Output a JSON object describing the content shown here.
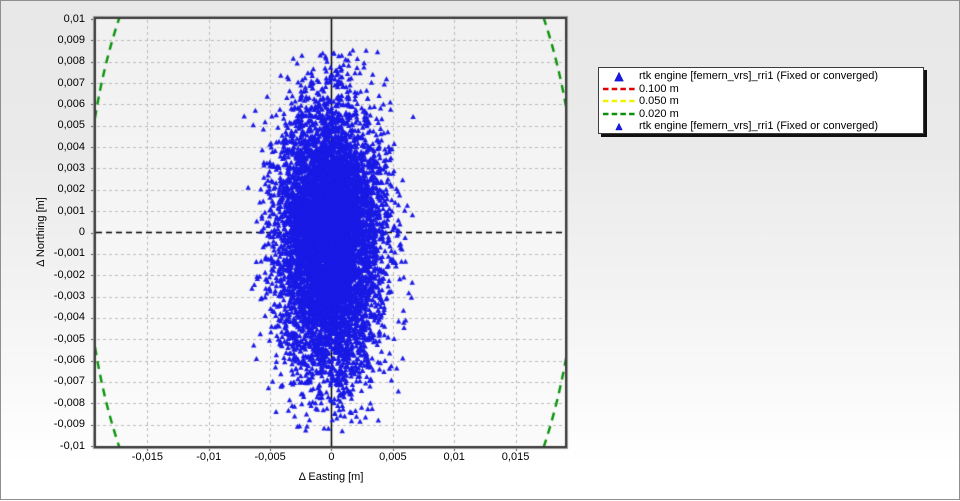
{
  "chart_data": {
    "type": "scatter",
    "xlabel": "Δ Easting [m]",
    "ylabel": "Δ Northing [m]",
    "xlim": [
      -0.01919,
      0.01903
    ],
    "ylim": [
      -0.01,
      0.01
    ],
    "x_ticks": [
      {
        "v": -0.015,
        "label": "-0,015"
      },
      {
        "v": -0.01,
        "label": "-0,01"
      },
      {
        "v": -0.005,
        "label": "-0,005"
      },
      {
        "v": 0,
        "label": "0"
      },
      {
        "v": 0.005,
        "label": "0,005"
      },
      {
        "v": 0.01,
        "label": "0,01"
      },
      {
        "v": 0.015,
        "label": "0,015"
      }
    ],
    "y_ticks": [
      {
        "v": 0.01,
        "label": "0,01"
      },
      {
        "v": 0.009,
        "label": "0,009"
      },
      {
        "v": 0.008,
        "label": "0,008"
      },
      {
        "v": 0.007,
        "label": "0,007"
      },
      {
        "v": 0.006,
        "label": "0,006"
      },
      {
        "v": 0.005,
        "label": "0,005"
      },
      {
        "v": 0.004,
        "label": "0,004"
      },
      {
        "v": 0.003,
        "label": "0,003"
      },
      {
        "v": 0.002,
        "label": "0,002"
      },
      {
        "v": 0.001,
        "label": "0,001"
      },
      {
        "v": 0,
        "label": "0"
      },
      {
        "v": -0.001,
        "label": "-0,001"
      },
      {
        "v": -0.002,
        "label": "-0,002"
      },
      {
        "v": -0.003,
        "label": "-0,003"
      },
      {
        "v": -0.004,
        "label": "-0,004"
      },
      {
        "v": -0.005,
        "label": "-0,005"
      },
      {
        "v": -0.006,
        "label": "-0,006"
      },
      {
        "v": -0.007,
        "label": "-0,007"
      },
      {
        "v": -0.008,
        "label": "-0,008"
      },
      {
        "v": -0.009,
        "label": "-0,009"
      },
      {
        "v": -0.01,
        "label": "-0,01"
      }
    ],
    "grid": {
      "x_major_step": 0.005,
      "y_major_step": 0.001,
      "x_minor_tick": 0.001,
      "y_minor_tick": 0.0002,
      "style": "dashed",
      "color": "#bcbcbc",
      "zero_x_line": "solid-black",
      "zero_y_line": "dashed-black"
    },
    "series": [
      {
        "name": "rtk engine [femern_vrs]_rri1 (Fixed or converged)",
        "marker": "triangle",
        "color": "#1a1ae6",
        "n": 8000,
        "center": [
          -0.0002,
          -0.0003
        ],
        "sigma": [
          0.0021,
          0.0031
        ],
        "spread": [
          -0.0073,
          0.0069,
          -0.0091,
          0.0089
        ],
        "seed": 1337
      }
    ],
    "reference_circles": [
      {
        "radius_m": 0.1,
        "label": "0.100 m",
        "color": "#e00000"
      },
      {
        "radius_m": 0.05,
        "label": "0.050 m",
        "color": "#f2f200"
      },
      {
        "radius_m": 0.02,
        "label": "0.020 m",
        "color": "#0a930a"
      }
    ]
  },
  "legend": {
    "items": [
      {
        "swatch": "triangle",
        "color": "#1a1ae6",
        "label": "rtk engine [femern_vrs]_rri1 (Fixed or converged)"
      },
      {
        "swatch": "dash",
        "color": "#e00000",
        "label": "0.100 m"
      },
      {
        "swatch": "dash",
        "color": "#f2f200",
        "label": "0.050 m"
      },
      {
        "swatch": "dash",
        "color": "#0a930a",
        "label": "0.020 m"
      },
      {
        "swatch": "triangle-small",
        "color": "#1a1ae6",
        "label": "rtk engine [femern_vrs]_rri1 (Fixed or converged)"
      }
    ]
  }
}
